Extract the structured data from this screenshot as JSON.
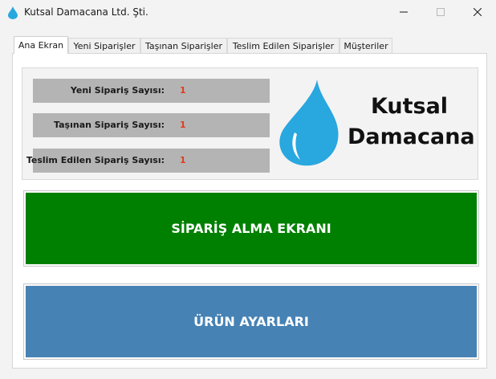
{
  "window": {
    "title": "Kutsal Damacana Ltd. Şti.",
    "icon": "water-drop-icon",
    "controls": [
      "minimize-icon",
      "maximize-icon",
      "close-icon"
    ]
  },
  "tabs": [
    {
      "label": "Ana Ekran",
      "active": true
    },
    {
      "label": "Yeni Siparişler",
      "active": false
    },
    {
      "label": "Taşınan Siparişler",
      "active": false
    },
    {
      "label": "Teslim Edilen Siparişler",
      "active": false
    },
    {
      "label": "Müşteriler",
      "active": false
    }
  ],
  "stats": [
    {
      "label": "Yeni Sipariş Sayısı:",
      "value": "1"
    },
    {
      "label": "Taşınan Sipariş Sayısı:",
      "value": "1"
    },
    {
      "label": "Teslim Edilen Sipariş Sayısı:",
      "value": "1"
    }
  ],
  "brand": {
    "line1": "Kutsal",
    "line2": "Damacana",
    "logo_icon": "water-drop-icon",
    "logo_color": "#29a7df"
  },
  "buttons": {
    "order": {
      "label": "SİPARİŞ ALMA EKRANI",
      "color": "#008000"
    },
    "product": {
      "label": "ÜRÜN AYARLARI",
      "color": "#4682b4"
    }
  },
  "colors": {
    "stat_value": "#e03c1e",
    "stat_bg": "#b4b4b4"
  }
}
